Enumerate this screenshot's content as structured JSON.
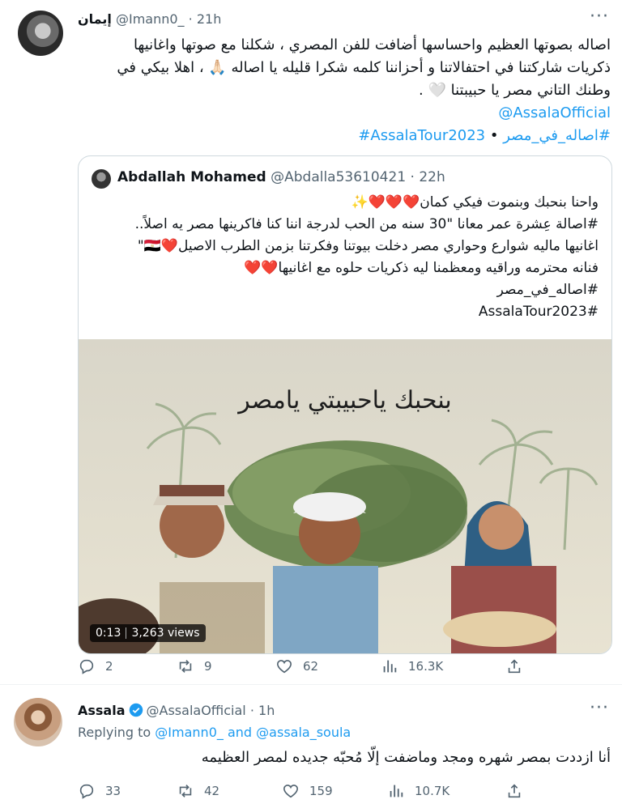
{
  "tweet1": {
    "display_name": "إيمان",
    "handle": "@Imann0_",
    "time": "21h",
    "lines": [
      "اصاله بصوتها العظيم واحساسها أضافت للفن المصري ، شكلنا مع صوتها واغانيها",
      "ذكريات شاركتنا في احتفالاتنا و أحزاننا كلمه شكرا قليله يا اصاله 🙏🏻 ، اهلا بيكي في",
      "وطنك التاني مصر يا حبيبتنا 🤍 ."
    ],
    "mention": "@AssalaOfficial",
    "hashtag_ar": "#اصاله_في_مصر",
    "hashtag_separator": "•",
    "hashtag_en": "#AssalaTour2023",
    "actions": {
      "replies": "",
      "retweets": "",
      "likes": "",
      "views": ""
    }
  },
  "quote": {
    "display_name": "Abdallah Mohamed",
    "handle": "@Abdalla53610421",
    "time": "22h",
    "lines": [
      "واحنا بنحبك وبنموت فيكي كمان❤️❤️❤️✨",
      "#اصالة عِشرة عمر معانا \"30 سنه من الحب لدرجة اننا كنا فاكرينها مصر يه اصلاً..",
      "اغانيها ماليه شوارع وحواري مصر دخلت بيوتنا وفكرتنا بزمن الطرب الاصيل❤️🇪🇬\"",
      "فنانه محترمه وراقيه ومعظمنا ليه ذكريات حلوه مع اغانيها❤️❤️",
      "#اصاله_في_مصر",
      "#AssalaTour2023"
    ],
    "video_caption": "بنحبك ياحبيبتي يامصر",
    "video_time": "0:13",
    "video_views": "3,263 views"
  },
  "tweet1_actions": {
    "replies": "2",
    "retweets": "9",
    "likes": "62",
    "views": "16.3K"
  },
  "tweet2": {
    "display_name": "Assala",
    "handle": "@AssalaOfficial",
    "time": "1h",
    "replying_prefix": "Replying to",
    "reply_to_1": "@Imann0_",
    "reply_and": "and",
    "reply_to_2": "@assala_soula",
    "text": "أنا ازددت بمصر شهره ومجد وماضفت إلّا مُحبّه جديده لمصر العظيمه",
    "replies": "33",
    "retweets": "42",
    "likes": "159",
    "views": "10.7K"
  },
  "colors": {
    "accent": "#1d9bf0",
    "muted": "#536471",
    "text": "#0f1419"
  },
  "icons": [
    "more-icon",
    "reply-icon",
    "retweet-icon",
    "like-icon",
    "views-icon",
    "share-icon",
    "verified-icon"
  ]
}
